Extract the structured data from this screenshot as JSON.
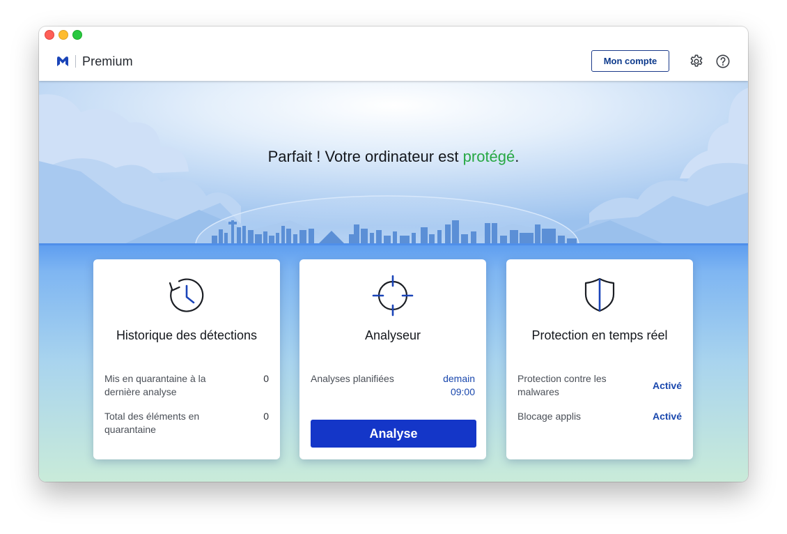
{
  "app": {
    "name": "Premium",
    "account_label": "Mon compte"
  },
  "icons": {
    "logo": "malwarebytes-logo-icon",
    "settings": "gear-icon",
    "help": "help-icon"
  },
  "colors": {
    "accent": "#1436c8",
    "success": "#27a844",
    "link": "#1947ad"
  },
  "hero": {
    "headline_prefix": "Parfait ! Votre ordinateur est ",
    "headline_status": "protégé",
    "headline_suffix": "."
  },
  "cards": {
    "history": {
      "icon": "history-clock-icon",
      "title": "Historique des détections",
      "rows": [
        {
          "label": "Mis en quarantaine à la dernière analyse",
          "value": "0"
        },
        {
          "label": "Total des éléments en quarantaine",
          "value": "0"
        }
      ]
    },
    "scanner": {
      "icon": "crosshair-icon",
      "title": "Analyseur",
      "rows": [
        {
          "label": "Analyses planifiées",
          "value": "demain 09:00"
        }
      ],
      "button_label": "Analyse"
    },
    "protection": {
      "icon": "shield-icon",
      "title": "Protection en temps réel",
      "rows": [
        {
          "label": "Protection contre les malwares",
          "value": "Activé"
        },
        {
          "label": "Blocage applis",
          "value": "Activé"
        }
      ]
    }
  }
}
